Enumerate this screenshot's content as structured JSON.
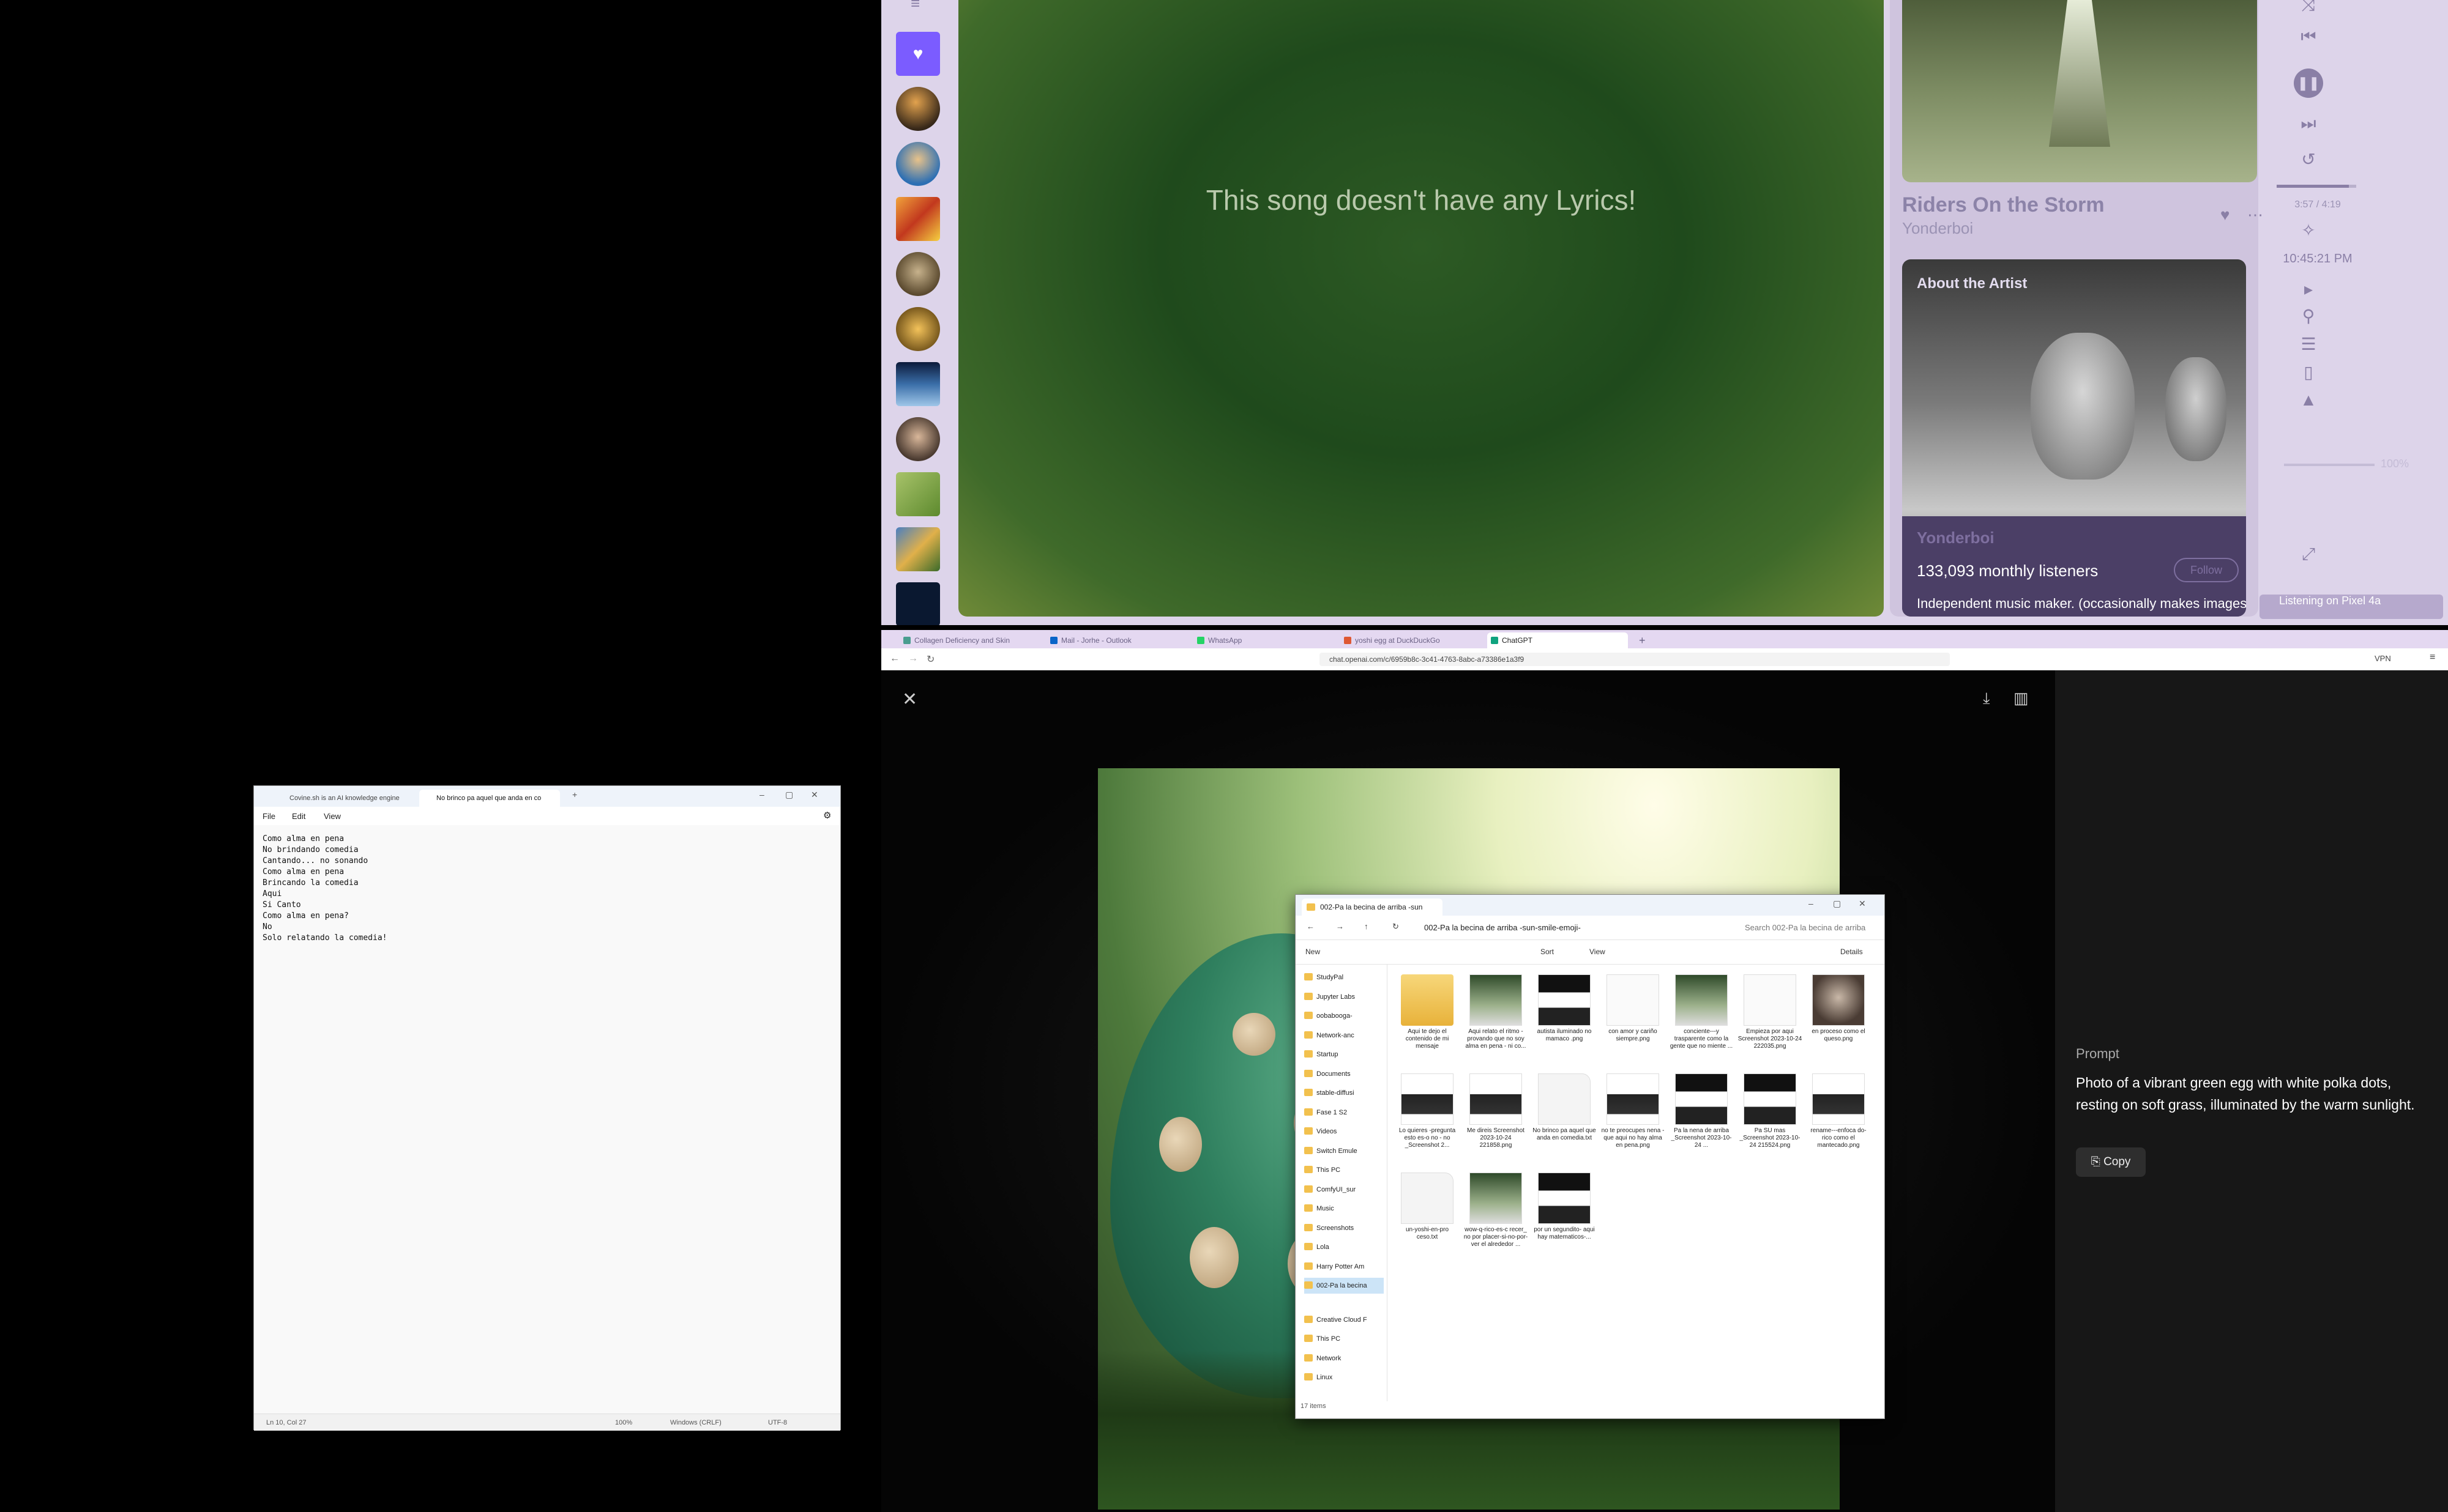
{
  "music": {
    "lyrics_message": "This song doesn't have any Lyrics!",
    "song_title": "Riders On the Storm",
    "artist": "Yonderboi",
    "about_label": "About the Artist",
    "about_artist_name": "Yonderboi",
    "monthly_listeners": "133,093 monthly listeners",
    "follow_label": "Follow",
    "bio": "Independent music maker. (occasionally makes images",
    "time": "3:57 / 4:19",
    "progress_fraction": 0.91,
    "clock": "10:45:21 PM",
    "volume": "100%",
    "listening": "Listening on Pixel 4a"
  },
  "browser": {
    "tabs": [
      {
        "label": "Collagen Deficiency and Skin",
        "color": "#4a9d8f"
      },
      {
        "label": "Mail - Jorhe - Outlook",
        "color": "#0a64c8"
      },
      {
        "label": "WhatsApp",
        "color": "#25d366"
      },
      {
        "label": "yoshi egg at DuckDuckGo",
        "color": "#de5833"
      },
      {
        "label": "ChatGPT",
        "color": "#10a37f"
      }
    ],
    "url": "chat.openai.com/c/6959b8c-3c41-4763-8abc-a73386e1a3f9",
    "vpn": "VPN",
    "prompt_label": "Prompt",
    "prompt_text": "Photo of a vibrant green egg with white polka dots, resting on soft grass, illuminated by the warm sunlight.",
    "copy_label": "Copy"
  },
  "explorer": {
    "tab_title": "002-Pa la becina de arriba -sun",
    "path": "002-Pa la becina de arriba -sun-smile-emoji-",
    "search_placeholder": "Search 002-Pa la becina de arriba",
    "cmd": {
      "new": "New",
      "sort": "Sort",
      "view": "View",
      "details": "Details"
    },
    "nav": [
      "StudyPal",
      "Jupyter Labs",
      "oobabooga-",
      "Network-anc",
      "Startup",
      "Documents",
      "stable-diffusi",
      "Fase 1 S2",
      "Videos",
      "Switch Emule",
      "This PC",
      "ComfyUI_sur",
      "Music",
      "Screenshots",
      "Lola",
      "Harry Potter Am",
      "002-Pa la becina",
      "Creative Cloud F",
      "This PC",
      "Network",
      "Linux"
    ],
    "files": [
      {
        "name": "Aqui te dejo el contenido de mi mensaje",
        "kind": "folder"
      },
      {
        "name": "Aqui relato el ritmo - provando que no soy alma en pena - ni co...",
        "kind": "shot"
      },
      {
        "name": "autista iluminado no mamaco .png",
        "kind": "dark"
      },
      {
        "name": "con amor y cariño siempre.png",
        "kind": "doc"
      },
      {
        "name": "conciente---y trasparente como la gente que no miente ...",
        "kind": "shot"
      },
      {
        "name": "Empieza por aqui Screenshot 2023-10-24 222035.png",
        "kind": "doc"
      },
      {
        "name": "en proceso como el queso.png",
        "kind": "photo"
      },
      {
        "name": "Lo quieres -pregunta esto es-o no - no _Screenshot 2...",
        "kind": "doc2"
      },
      {
        "name": "Me direis Screenshot 2023-10-24 221858.png",
        "kind": "doc2"
      },
      {
        "name": "No brinco pa aquel que anda en comedia.txt",
        "kind": "txt"
      },
      {
        "name": "no te preocupes nena - que aqui no hay alma en pena.png",
        "kind": "doc2"
      },
      {
        "name": "Pa la nena de arriba _Screenshot 2023-10-24 ...",
        "kind": "dark"
      },
      {
        "name": "Pa SU mas _Screenshot 2023-10-24 215524.png",
        "kind": "dark"
      },
      {
        "name": "rename---enfoca do-rico como el mantecado.png",
        "kind": "doc2"
      },
      {
        "name": "un-yoshi-en-pro ceso.txt",
        "kind": "txt"
      },
      {
        "name": "wow-q-rico-es-c recer_ no por placer-si-no-por- ver el alrededor ...",
        "kind": "shot"
      },
      {
        "name": "por un segundito- aqui hay matematicos-...",
        "kind": "dark"
      }
    ],
    "status": "17 items"
  },
  "notepad": {
    "tabs": [
      "Covine.sh is an AI knowledge engine",
      "No brinco pa aquel que anda en co"
    ],
    "menu": [
      "File",
      "Edit",
      "View"
    ],
    "lines": [
      "Como alma en pena",
      "No brindando comedia",
      "Cantando... no sonando",
      "Como alma en pena",
      "Brincando la comedia",
      "Aqui",
      "Si Canto",
      "Como alma en pena?",
      "No",
      "Solo relatando la comedia!"
    ],
    "status": {
      "pos": "Ln 10, Col 27",
      "zoom": "100%",
      "eol": "Windows (CRLF)",
      "enc": "UTF-8"
    }
  }
}
